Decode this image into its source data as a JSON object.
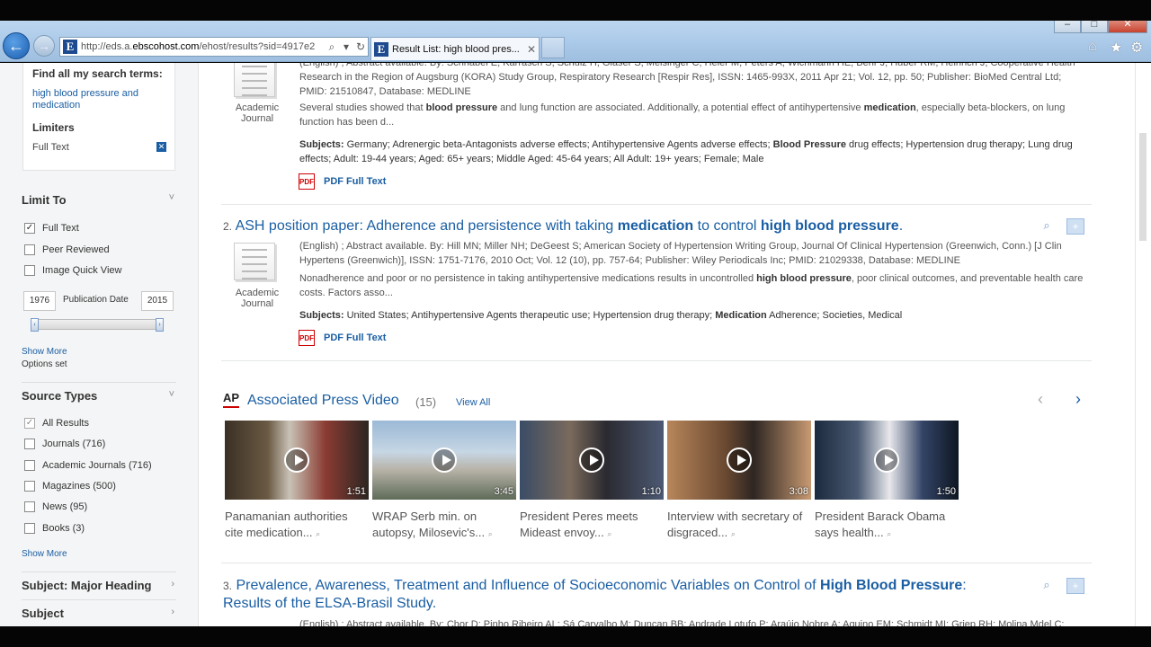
{
  "browser": {
    "address_prefix": "http://eds.a.",
    "address_host": "ebscohost.com",
    "address_rest": "/ehost/results?sid=4917e2",
    "tab_title": "Result List: high blood pres...",
    "favicon_letter": "E",
    "icons": [
      "back-icon",
      "forward-icon",
      "search-icon",
      "refresh-icon",
      "home-icon",
      "star-icon",
      "gear-icon",
      "close-icon"
    ]
  },
  "sidebar": {
    "find_all": "Find all my search terms:",
    "search_terms": "high blood pressure and medication",
    "limiters_title": "Limiters",
    "limiter_item": "Full Text",
    "limit_to": {
      "title": "Limit To",
      "options": [
        {
          "label": "Full Text",
          "checked": true
        },
        {
          "label": "Peer Reviewed",
          "checked": false
        },
        {
          "label": "Image Quick View",
          "checked": false
        }
      ],
      "date_from": "1976",
      "date_label": "Publication Date",
      "date_to": "2015",
      "show_more": "Show More",
      "options_set": "Options set"
    },
    "source_types": {
      "title": "Source Types",
      "options": [
        {
          "label": "All Results",
          "checked": true
        },
        {
          "label": "Journals",
          "count": "(716)",
          "checked": false
        },
        {
          "label": "Academic Journals",
          "count": "(716)",
          "checked": false
        },
        {
          "label": "Magazines",
          "count": "(500)",
          "checked": false
        },
        {
          "label": "News",
          "count": "(95)",
          "checked": false
        },
        {
          "label": "Books",
          "count": "(3)",
          "checked": false
        }
      ],
      "show_more": "Show More"
    },
    "subject_major": "Subject: Major Heading",
    "subject": "Subject"
  },
  "results": {
    "r1": {
      "meta": "(English) ; Abstract available. By: Schnabel E; Karrasch S; Schulz H; Gläser S; Meisinger C; Heier M; Peters A; Wichmann HE; Behr J; Huber RM; Heinrich J; Cooperative Health Research in the Region of Augsburg (KORA) Study Group, Respiratory Research [Respir Res], ISSN: 1465-993X, 2011 Apr 21; Vol. 12, pp. 50; Publisher: BioMed Central Ltd; PMID: 21510847, Database: MEDLINE",
      "abstract_a": "Several studies showed that ",
      "abstract_b": "blood pressure",
      "abstract_c": " and lung function are associated. Additionally, a potential effect of antihypertensive ",
      "abstract_d": "medication",
      "abstract_e": ", especially beta-blockers, on lung function has been d...",
      "subjects_label": "Subjects:",
      "subjects_a": " Germany; Adrenergic beta-Antagonists adverse effects; Antihypertensive Agents adverse effects; ",
      "subjects_b": "Blood Pressure",
      "subjects_c": " drug effects; Hypertension drug therapy; Lung drug effects; Adult: 19-44 years; Aged: 65+ years; Middle Aged: 45-64 years; All Adult: 19+ years; Female; Male",
      "type": "Academic Journal",
      "pdf": "PDF Full Text"
    },
    "r2": {
      "num": "2.",
      "title_a": "ASH position paper: Adherence and persistence with taking ",
      "title_b": "medication",
      "title_c": " to control ",
      "title_d": "high blood pressure",
      "title_e": ".",
      "meta": "(English) ; Abstract available. By: Hill MN; Miller NH; DeGeest S; American Society of Hypertension Writing Group, Journal Of Clinical Hypertension (Greenwich, Conn.) [J Clin Hypertens (Greenwich)], ISSN: 1751-7176, 2010 Oct; Vol. 12 (10), pp. 757-64; Publisher: Wiley Periodicals Inc; PMID: 21029338, Database: MEDLINE",
      "abstract_a": "Nonadherence and poor or no persistence in taking antihypertensive medications results in uncontrolled ",
      "abstract_b": "high blood pressure",
      "abstract_c": ", poor clinical outcomes, and preventable health care costs. Factors asso...",
      "subjects_label": "Subjects:",
      "subjects_a": " United States; Antihypertensive Agents therapeutic use; Hypertension drug therapy; ",
      "subjects_b": "Medication",
      "subjects_c": " Adherence; Societies, Medical",
      "type": "Academic Journal",
      "pdf": "PDF Full Text"
    },
    "r3": {
      "num": "3.",
      "title_a": "Prevalence, Awareness, Treatment and Influence of Socioeconomic Variables on Control of ",
      "title_b": "High Blood Pressure",
      "title_c": ": Results of the ELSA-Brasil Study.",
      "meta": "(English) ; Abstract available. By: Chor D; Pinho Ribeiro AL; Sá Carvalho M; Duncan BB; Andrade Lotufo P; Araújo Nobre A; Aquino EM; Schmidt MI; Griep RH; Molina Mdel C;"
    }
  },
  "ap": {
    "logo": "AP",
    "title": "Associated Press Video",
    "count": "(15)",
    "view_all": "View All",
    "videos": [
      {
        "duration": "1:51",
        "caption": "Panamanian authorities cite medication..."
      },
      {
        "duration": "3:45",
        "caption": "WRAP Serb min. on autopsy, Milosevic's..."
      },
      {
        "duration": "1:10",
        "caption": "President Peres meets Mideast envoy..."
      },
      {
        "duration": "3:08",
        "caption": "Interview with secretary of disgraced..."
      },
      {
        "duration": "1:50",
        "caption": "President Barack Obama says health..."
      }
    ]
  },
  "colors": {
    "link": "#1a5ea3",
    "accent_red": "#cc0000"
  }
}
